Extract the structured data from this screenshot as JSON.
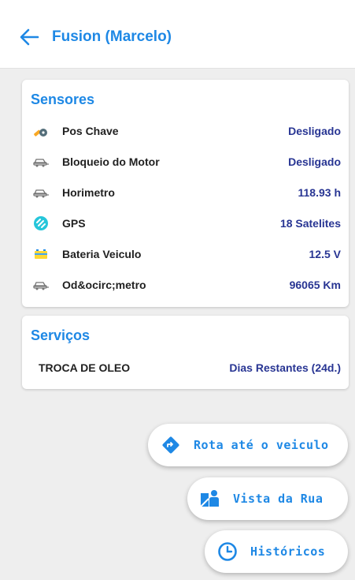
{
  "header": {
    "title": "Fusion (Marcelo)"
  },
  "sensors": {
    "title": "Sensores",
    "rows": [
      {
        "icon": "key-icon",
        "label": "Pos Chave",
        "value": "Desligado"
      },
      {
        "icon": "car-icon",
        "label": "Bloqueio do Motor",
        "value": "Desligado"
      },
      {
        "icon": "car-icon",
        "label": "Horimetro",
        "value": "118.93 h"
      },
      {
        "icon": "satellite-icon",
        "label": "GPS",
        "value": "18 Satelites"
      },
      {
        "icon": "battery-icon",
        "label": "Bateria Veiculo",
        "value": "12.5 V"
      },
      {
        "icon": "car-icon",
        "label": "Od&ocirc;metro",
        "value": "96065 Km"
      }
    ]
  },
  "services": {
    "title": "Serviços",
    "item_label": "TROCA DE OLEO",
    "item_value": "Dias Restantes (24d.)"
  },
  "actions": {
    "route": "Rota até o veiculo",
    "street_view": "Vista da Rua",
    "history": "Históricos"
  },
  "colors": {
    "accent": "#1e88e5",
    "value": "#283593"
  }
}
